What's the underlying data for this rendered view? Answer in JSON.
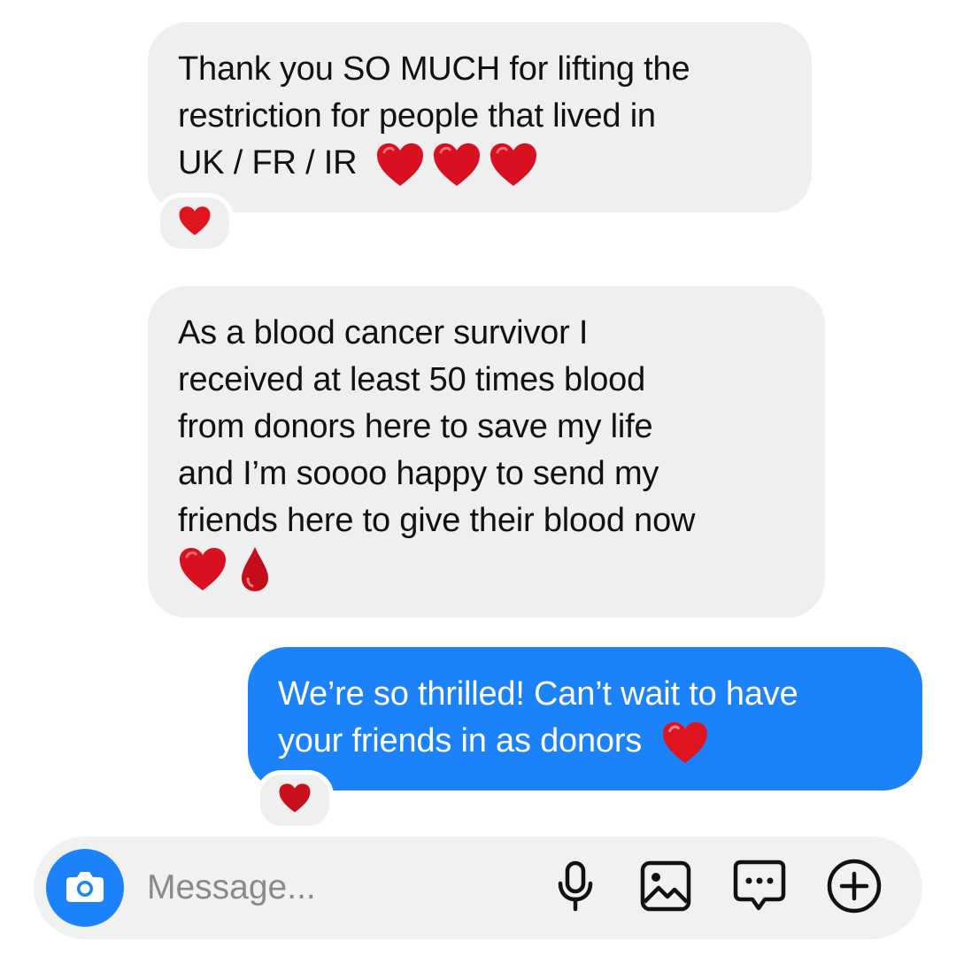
{
  "messages": [
    {
      "direction": "incoming",
      "lines": [
        "Thank you SO MUCH for lifting the",
        "restriction for people that lived in",
        "UK / FR / IR"
      ],
      "emojis": [
        "red-heart",
        "red-heart",
        "red-heart"
      ],
      "reaction": "red-heart"
    },
    {
      "direction": "incoming",
      "lines": [
        "As a blood cancer survivor I",
        "received at least 50 times blood",
        "from donors here to save my life",
        "and I’m soooo happy to send my",
        "friends here to give their blood now"
      ],
      "emojis": [
        "red-heart",
        "drop-of-blood"
      ]
    },
    {
      "direction": "outgoing",
      "lines": [
        "We’re so thrilled! Can’t wait to have",
        "your friends in as donors"
      ],
      "emojis": [
        "red-heart"
      ],
      "reaction": "red-heart"
    }
  ],
  "composer": {
    "placeholder": "Message...",
    "value": "",
    "camera_icon": "camera-icon",
    "tools": [
      "microphone-icon",
      "gallery-icon",
      "sticker-message-icon",
      "plus-icon"
    ]
  },
  "colors": {
    "incoming_bubble": "#efefef",
    "outgoing_bubble": "#1b82f9",
    "heart": "#d8101f",
    "composer_bg": "#f1f1f1",
    "icon": "#111111"
  }
}
